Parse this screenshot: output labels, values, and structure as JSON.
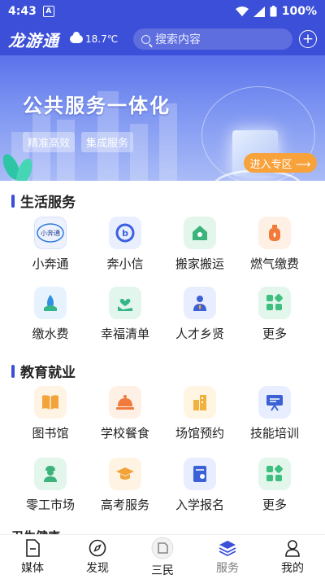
{
  "status_bar": {
    "time": "4:43",
    "notification_letter": "A",
    "battery": "100%"
  },
  "header": {
    "logo": "龙游通",
    "temperature": "18.7℃",
    "search_placeholder": "搜索内容"
  },
  "banner": {
    "title": "公共服务一体化",
    "tags": [
      "精准高效",
      "集成服务"
    ],
    "enter_label": "进入专区 ⟶"
  },
  "sections": [
    {
      "title": "生活服务",
      "items": [
        {
          "label": "小奔通",
          "icon": "xiaobentong-logo-icon",
          "bg": "#eef2ff",
          "fg": "#2d7bd8"
        },
        {
          "label": "奔小信",
          "icon": "benxiaoxin-logo-icon",
          "bg": "#e9efff",
          "fg": "#3b5fe0"
        },
        {
          "label": "搬家搬运",
          "icon": "house-icon",
          "bg": "#e3f6ec",
          "fg": "#3bb37a"
        },
        {
          "label": "燃气缴费",
          "icon": "gas-tank-icon",
          "bg": "#fff0e6",
          "fg": "#f27b3a"
        },
        {
          "label": "缴水费",
          "icon": "water-drop-icon",
          "bg": "#e6f3ff",
          "fg": "#2f8fe0"
        },
        {
          "label": "幸福清单",
          "icon": "heart-hand-icon",
          "bg": "#e3f6ee",
          "fg": "#35b686"
        },
        {
          "label": "人才乡贤",
          "icon": "person-tie-icon",
          "bg": "#e8eeff",
          "fg": "#3a62d6"
        },
        {
          "label": "更多",
          "icon": "grid-more-icon",
          "bg": "#e3f6ec",
          "fg": "#3fbf7f"
        }
      ]
    },
    {
      "title": "教育就业",
      "items": [
        {
          "label": "图书馆",
          "icon": "open-book-icon",
          "bg": "#fff3e3",
          "fg": "#f2a33a"
        },
        {
          "label": "学校餐食",
          "icon": "food-cloche-icon",
          "bg": "#fff0e6",
          "fg": "#ef7a3c"
        },
        {
          "label": "场馆预约",
          "icon": "building-icon",
          "bg": "#fff5e3",
          "fg": "#f0b23c"
        },
        {
          "label": "技能培训",
          "icon": "presentation-board-icon",
          "bg": "#e8eeff",
          "fg": "#3a62d6"
        },
        {
          "label": "零工市场",
          "icon": "worker-icon",
          "bg": "#e3f6ec",
          "fg": "#3bb37a"
        },
        {
          "label": "高考服务",
          "icon": "graduation-cap-icon",
          "bg": "#fff3e3",
          "fg": "#f2a33a"
        },
        {
          "label": "入学报名",
          "icon": "enrollment-form-icon",
          "bg": "#e8eeff",
          "fg": "#3a62d6"
        },
        {
          "label": "更多",
          "icon": "grid-more-icon",
          "bg": "#e3f6ec",
          "fg": "#3fbf7f"
        }
      ]
    }
  ],
  "partial_section_title": "卫生健康",
  "tabs": [
    {
      "label": "媒体",
      "icon": "document-icon"
    },
    {
      "label": "发现",
      "icon": "compass-icon"
    },
    {
      "label": "三民",
      "icon": "sanmin-badge-icon"
    },
    {
      "label": "服务",
      "icon": "layers-icon",
      "active": true
    },
    {
      "label": "我的",
      "icon": "person-icon"
    }
  ],
  "colors": {
    "brand": "#3b4fd8",
    "accent_orange": "#f7a23b"
  }
}
